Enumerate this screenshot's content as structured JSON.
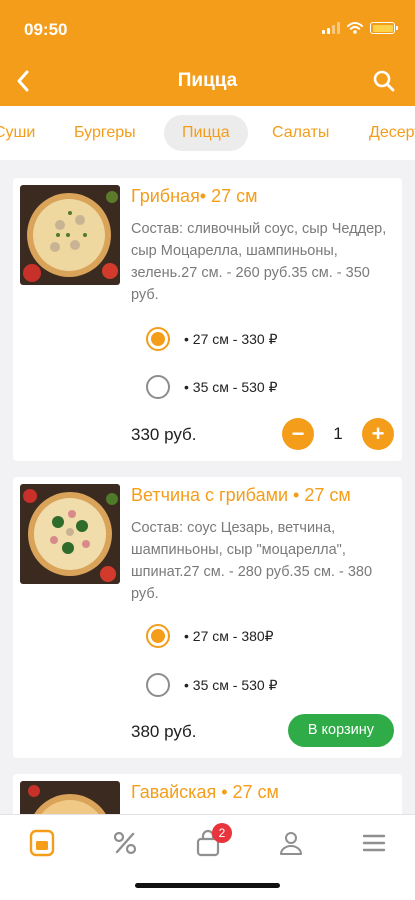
{
  "status": {
    "time": "09:50"
  },
  "header": {
    "title": "Пицца"
  },
  "tabs": [
    {
      "label": "Суши"
    },
    {
      "label": "Бургеры"
    },
    {
      "label": "Пицца",
      "active": true
    },
    {
      "label": "Салаты"
    },
    {
      "label": "Десерты"
    }
  ],
  "products": [
    {
      "title": "Грибная• 27 см",
      "description": "Состав: сливочный соус, сыр Чеддер, сыр Моцарелла, шампиньоны, зелень.27 см. - 260 руб.35 см. - 350 руб.",
      "options": [
        {
          "label": "• 27 см - 330 ₽",
          "selected": true
        },
        {
          "label": "• 35 см - 530 ₽",
          "selected": false
        }
      ],
      "price": "330 руб.",
      "quantity": "1",
      "minus_label": "−",
      "plus_label": "+"
    },
    {
      "title": "Ветчина с грибами • 27 см",
      "description": "Состав: соус Цезарь, ветчина, шампиньоны, сыр \"моцарелла\", шпинат.27 см. - 280 руб.35 см. - 380 руб.",
      "options": [
        {
          "label": "• 27 см - 380₽",
          "selected": true
        },
        {
          "label": "• 35 см - 530 ₽",
          "selected": false
        }
      ],
      "price": "380 руб.",
      "cart_button": "В корзину"
    },
    {
      "title": "Гавайская • 27 см"
    }
  ],
  "bottom_nav": {
    "items": [
      "menu-icon",
      "discount-icon",
      "cart-icon",
      "profile-icon",
      "hamburger-icon"
    ],
    "cart_badge": "2"
  },
  "colors": {
    "accent": "#f49d1a",
    "cart_button": "#2fac48",
    "badge": "#e8343c"
  }
}
